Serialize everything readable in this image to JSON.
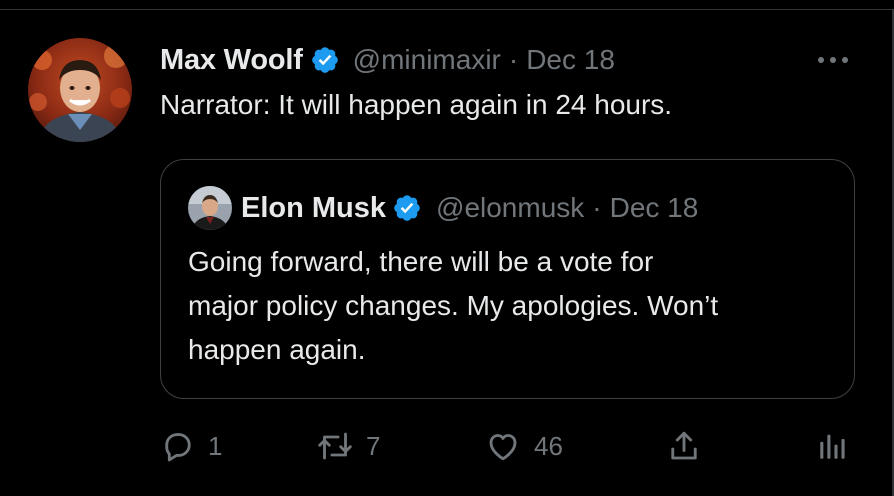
{
  "tweet": {
    "author_name": "Max Woolf",
    "handle": "@minimaxir",
    "separator": "·",
    "date": "Dec 18",
    "text": "Narrator: It will happen again in 24 hours."
  },
  "quoted": {
    "author_name": "Elon Musk",
    "handle": "@elonmusk",
    "separator": "·",
    "date": "Dec 18",
    "text_lines": [
      "Going forward, there will be a vote for",
      "major policy changes. My apologies. Won’t",
      "happen again."
    ]
  },
  "actions": {
    "reply_count": "1",
    "retweet_count": "7",
    "like_count": "46"
  },
  "colors": {
    "background": "#000000",
    "text": "#e7e9ea",
    "muted": "#71767b",
    "verified": "#1d9bf0",
    "border": "#3e4144"
  },
  "icons": [
    "verified-badge-icon",
    "more-options-icon",
    "reply-icon",
    "retweet-icon",
    "like-icon",
    "share-icon",
    "analytics-icon"
  ]
}
